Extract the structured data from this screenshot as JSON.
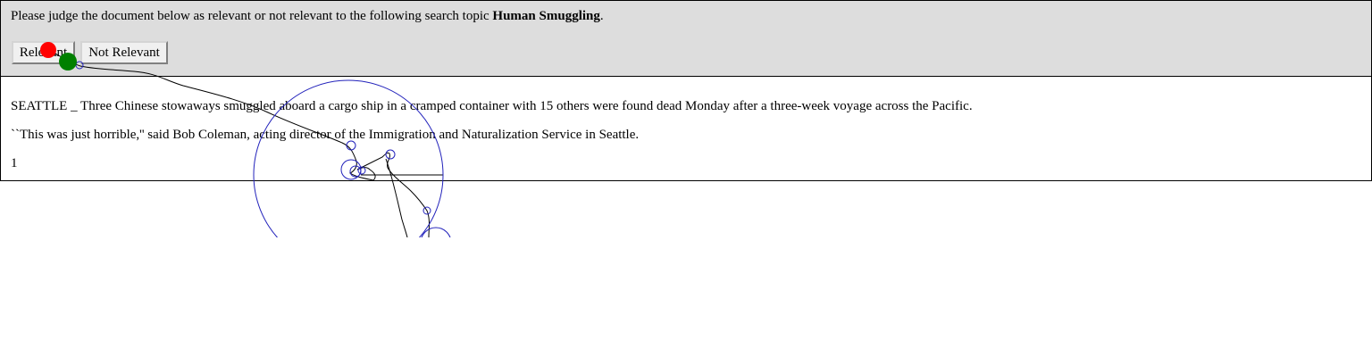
{
  "header": {
    "instruction_prefix": "Please judge the document below as relevant or not relevant to the following search topic ",
    "topic": "Human Smuggling",
    "instruction_suffix": "."
  },
  "buttons": {
    "relevant_label": "Relevant",
    "not_relevant_label": "Not Relevant"
  },
  "document": {
    "paragraphs": [
      "SEATTLE _ Three Chinese stowaways smuggled aboard a cargo ship in a cramped container with 15 others were found dead Monday after a three-week voyage across the Pacific.",
      "``This was just horrible,'' said Bob Coleman, acting director of the Immigration and Naturalization Service in Seattle.",
      "1"
    ]
  },
  "overlay": {
    "colors": {
      "start_marker": "#ff0000",
      "end_marker": "#008000",
      "path": "#000000",
      "fixation_circles": "#2222bb"
    }
  }
}
